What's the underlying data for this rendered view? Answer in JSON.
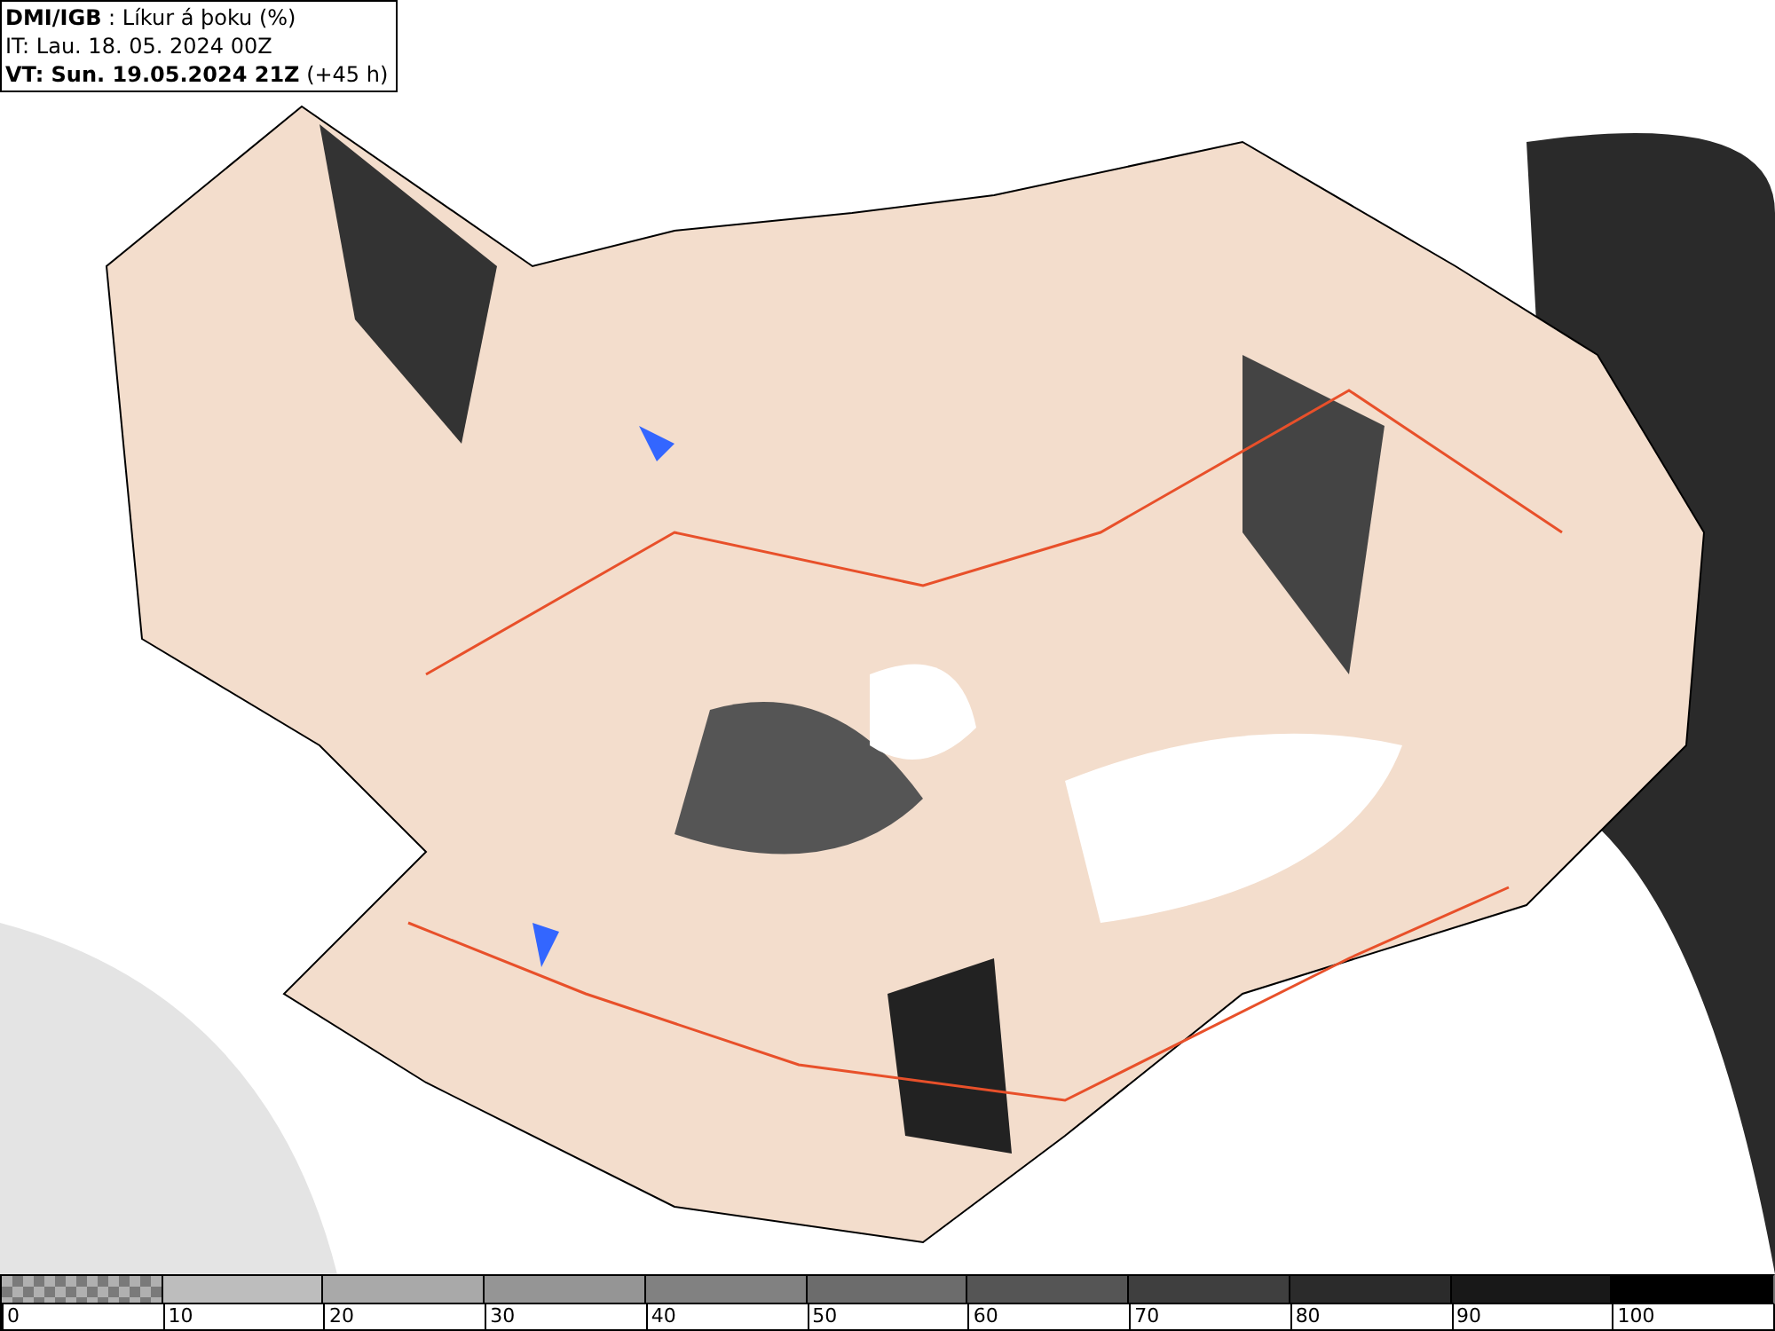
{
  "header": {
    "lines": [
      "**DMI/IGB** : Líkur á þoku (%)",
      "IT: Lau. 18. 05. 2024 00Z",
      "**VT: Sun. 19.05.2024 21Z** (+45 h)"
    ]
  },
  "legend": {
    "segments": [
      {
        "kind": "checker",
        "color": "#7a7a7a",
        "label": "0"
      },
      {
        "kind": "solid",
        "color": "#bdbdbd",
        "label": "10"
      },
      {
        "kind": "solid",
        "color": "#a9a9a9",
        "label": "20"
      },
      {
        "kind": "solid",
        "color": "#959595",
        "label": "30"
      },
      {
        "kind": "solid",
        "color": "#818181",
        "label": "40"
      },
      {
        "kind": "solid",
        "color": "#6c6c6c",
        "label": "50"
      },
      {
        "kind": "solid",
        "color": "#555555",
        "label": "60"
      },
      {
        "kind": "solid",
        "color": "#3f3f3f",
        "label": "70"
      },
      {
        "kind": "solid",
        "color": "#2b2b2b",
        "label": "80"
      },
      {
        "kind": "solid",
        "color": "#181818",
        "label": "90"
      },
      {
        "kind": "solid",
        "color": "#000000",
        "label": "100"
      }
    ]
  }
}
